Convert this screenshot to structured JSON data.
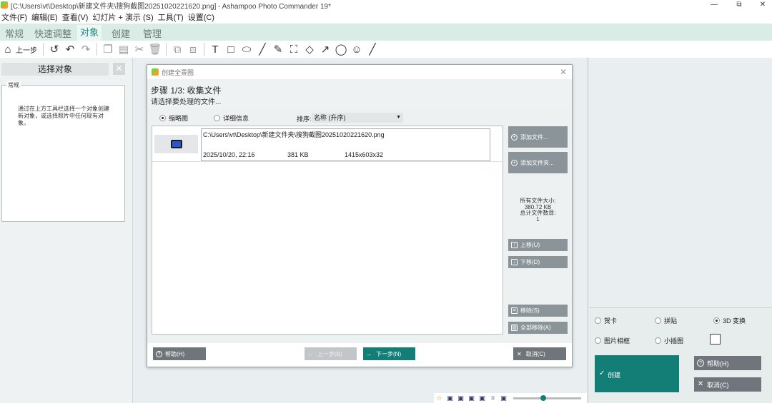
{
  "window": {
    "title": "[C:\\Users\\vt\\Desktop\\新建文件夹\\搜狗截图20251020221620.png] - Ashampoo Photo Commander 19*",
    "minimize": "—",
    "maximize": "⧉",
    "close": "✕"
  },
  "menu": [
    "文件(F)",
    "编辑(E)",
    "查看(V)",
    "幻灯片 + 演示 (S)",
    "工具(T)",
    "设置(C)"
  ],
  "tabs": [
    "常规",
    "快速调整",
    "对象",
    "创建",
    "管理"
  ],
  "active_tab": "对象",
  "toolbar": {
    "back_label": "上一步",
    "icons": [
      "home-icon",
      "undo-all-icon",
      "undo-icon",
      "redo-icon",
      "copy-icon",
      "paste-icon",
      "cut-icon",
      "delete-icon",
      "bring-front-icon",
      "send-back-icon",
      "text-icon",
      "rectangle-icon",
      "ellipse-icon",
      "line-icon",
      "pencil-icon",
      "folder-icon",
      "highlighter-icon",
      "arrow-icon",
      "speech-bubble-icon",
      "emoji-icon",
      "pen-icon"
    ]
  },
  "left_panel": {
    "header": "选择对象",
    "close": "✕",
    "group_legend": "常规",
    "description": "通过在上方工具栏选择一个对象创建新对象，或选择照片中任何现有对象。"
  },
  "dialog": {
    "title": "创建全景图",
    "close": "✕",
    "step_title": "步骤 1/3: 收集文件",
    "step_subtitle": "请选择要处理的文件...",
    "view_options": {
      "thumbnail": "缩略图",
      "details": "详细信息",
      "selected": "thumbnail"
    },
    "sort_label": "排序:",
    "sort_value": "名称 (升序)",
    "files": [
      {
        "path": "C:\\Users\\vt\\Desktop\\新建文件夹\\搜狗截图20251020221620.png",
        "date": "2025/10/20, 22:16",
        "size": "381 KB",
        "dimensions": "1415x603x32"
      }
    ],
    "buttons": {
      "add_files": "添加文件...",
      "add_folder": "添加文件夹...",
      "move_up": "上移(U)",
      "move_down": "下移(D)",
      "remove": "移除(S)",
      "remove_all": "全部移除(A)",
      "help": "帮助(H)",
      "prev": "上一步(B)",
      "next": "下一步(N)",
      "cancel": "取消(C)"
    },
    "stats": {
      "total_size_label": "所有文件大小:",
      "total_size": "380.72 KB",
      "total_count_label": "总计文件数目:",
      "total_count": "1"
    }
  },
  "right_panel": {
    "options": [
      {
        "label": "贺卡",
        "selected": false
      },
      {
        "label": "拼贴",
        "selected": false
      },
      {
        "label": "3D 变换",
        "selected": true
      },
      {
        "label": "图片相框",
        "selected": false
      },
      {
        "label": "小插图",
        "selected": false
      }
    ],
    "create": "创建",
    "help": "帮助(H)",
    "cancel": "取消(C)"
  },
  "statusbar": {
    "icons": [
      "star-icon",
      "image-icon",
      "image-icon",
      "image-icon",
      "image-icon",
      "crop-icon",
      "image-icon"
    ],
    "zoom_level": 0.4
  },
  "colors": {
    "accent": "#127e75",
    "tab_bg": "#d9ece6",
    "button_gray": "#6f757a"
  }
}
